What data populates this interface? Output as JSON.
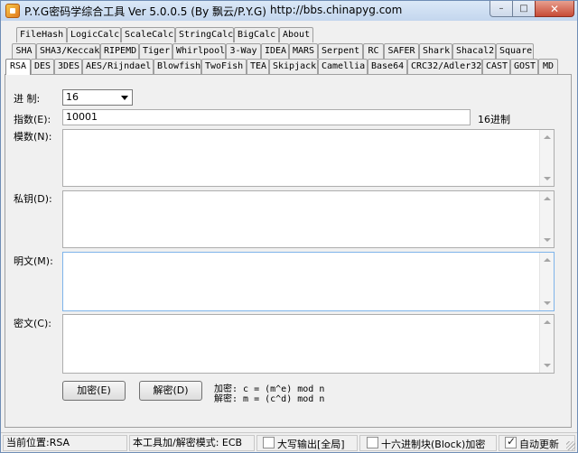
{
  "window": {
    "title": "P.Y.G密码学综合工具 Ver 5.0.0.5 (By 飘云/P.Y.G)",
    "url": "http://bbs.chinapyg.com",
    "min_glyph": "–",
    "max_glyph": "□",
    "close_glyph": "✕"
  },
  "tabs_row1": [
    "FileHash",
    "LogicCalc",
    "ScaleCalc",
    "StringCalc",
    "BigCalc",
    "About"
  ],
  "tabs_row2": [
    "SHA",
    "SHA3/Keccak",
    "RIPEMD",
    "Tiger",
    "Whirlpool",
    "3-Way",
    "IDEA",
    "MARS",
    "Serpent",
    "RC",
    "SAFER",
    "Shark",
    "Shacal2",
    "Square"
  ],
  "tabs_row3": [
    "RSA",
    "DES",
    "3DES",
    "AES/Rijndael",
    "Blowfish",
    "TwoFish",
    "TEA",
    "Skipjack",
    "Camellia",
    "Base64",
    "CRC32/Adler32",
    "CAST",
    "GOST",
    "MD"
  ],
  "form": {
    "radix_label": "进   制:",
    "radix_value": "16",
    "exponent_label": "指数(E):",
    "exponent_value": "10001",
    "exponent_suffix": "16进制",
    "modulus_label": "模数(N):",
    "modulus_value": "",
    "private_key_label": "私钥(D):",
    "private_key_value": "",
    "plaintext_label": "明文(M):",
    "plaintext_value": "",
    "ciphertext_label": "密文(C):",
    "ciphertext_value": ""
  },
  "buttons": {
    "encrypt": "加密(E)",
    "decrypt": "解密(D)"
  },
  "formulas": {
    "encrypt": "加密: c = (m^e) mod n",
    "decrypt": "解密: m = (c^d) mod n"
  },
  "status": {
    "location": "当前位置:RSA",
    "mode": "本工具加/解密模式: ECB",
    "uppercase_label": "大写输出[全局]",
    "uppercase_checked": false,
    "hex_block_label": "十六进制块(Block)加密",
    "hex_block_checked": false,
    "auto_update_label": "自动更新",
    "auto_update_checked": true
  }
}
